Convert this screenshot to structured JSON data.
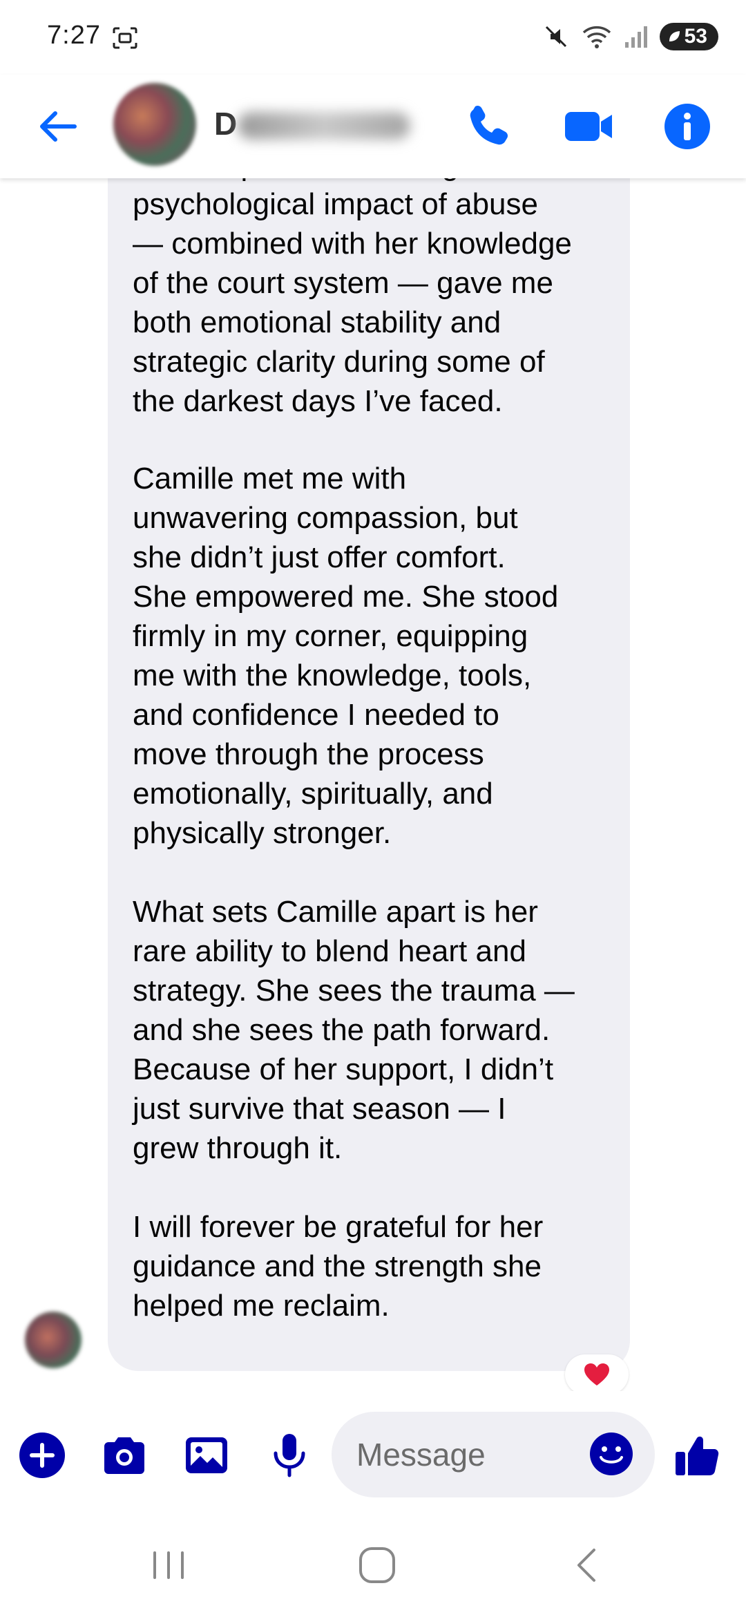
{
  "status_bar": {
    "time": "7:27",
    "battery": "53",
    "icons": [
      "screenshot-icon",
      "mute-icon",
      "wifi-icon",
      "signal-icon",
      "battery-saver-icon"
    ]
  },
  "header": {
    "contact_initial": "D",
    "icons": [
      "back-arrow-icon",
      "phone-icon",
      "video-icon",
      "info-icon"
    ],
    "accent_color": "#0866ff"
  },
  "conversation": {
    "paragraphs": [
      "Her deep understanding of the\npsychological impact of abuse\n— combined with her knowledge\nof the court system — gave me\nboth emotional stability and\nstrategic clarity during some of\nthe darkest days I’ve faced.",
      "Camille met me with\nunwavering compassion, but\nshe didn’t just offer comfort.\nShe empowered me. She stood\nfirmly in my corner, equipping\nme with the knowledge, tools,\nand confidence I needed to\nmove through the process\nemotionally, spiritually, and\nphysically stronger.",
      "What sets Camille apart is her\nrare ability to blend heart and\nstrategy. She sees the trauma —\nand she sees the path forward.\nBecause of her support, I didn’t\njust survive that season — I\ngrew through it.",
      "I will forever be grateful for her\nguidance and the strength she\nhelped me reclaim."
    ],
    "reaction": "heart-icon",
    "bubble_color": "#efeff4"
  },
  "composer": {
    "placeholder": "Message",
    "icons": [
      "plus-icon",
      "camera-icon",
      "gallery-icon",
      "microphone-icon",
      "emoji-icon",
      "thumbs-up-icon"
    ],
    "icon_color": "#0000a8"
  },
  "nav": {
    "icons": [
      "recent-apps-icon",
      "home-icon",
      "back-icon"
    ]
  }
}
